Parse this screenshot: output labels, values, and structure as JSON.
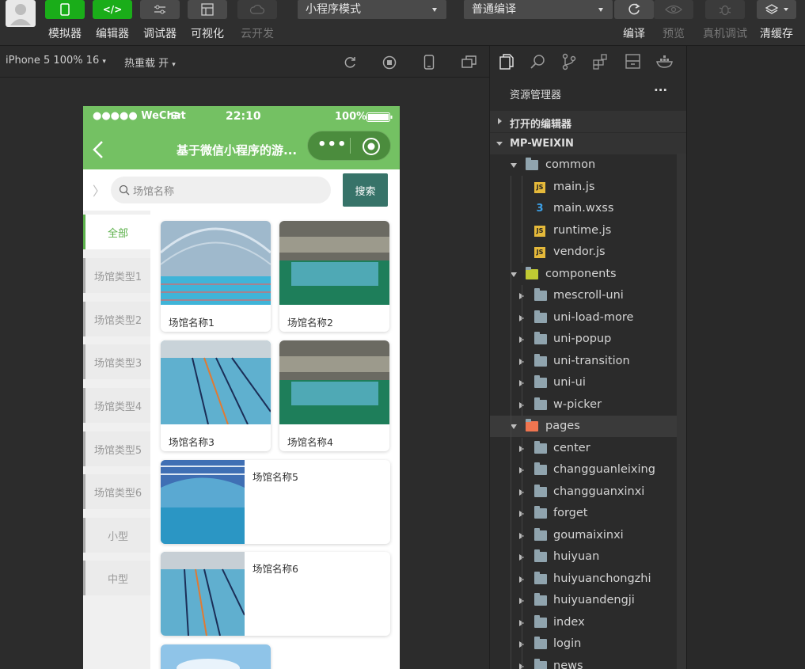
{
  "toolbar": {
    "buttons": [
      "模拟器",
      "编辑器",
      "调试器",
      "可视化",
      "云开发"
    ],
    "mode_select": "小程序模式",
    "compile_select": "普通编译",
    "right_labels": [
      "编译",
      "预览",
      "真机调试",
      "清缓存"
    ]
  },
  "subbar": {
    "device": "iPhone 5 100% 16",
    "hotreload": "热重载 开"
  },
  "phone": {
    "status": {
      "carrier": "●●●●● WeChat",
      "time": "22:10",
      "battery": "100%"
    },
    "nav_title": "基于微信小程序的游...",
    "search_placeholder": "场馆名称",
    "search_button": "搜索",
    "categories": [
      "全部",
      "场馆类型1",
      "场馆类型2",
      "场馆类型3",
      "场馆类型4",
      "场馆类型5",
      "场馆类型6",
      "小型",
      "中型"
    ],
    "cards": [
      "场馆名称1",
      "场馆名称2",
      "场馆名称3",
      "场馆名称4",
      "场馆名称5",
      "场馆名称6"
    ]
  },
  "explorer": {
    "title": "资源管理器",
    "more": "···",
    "open_editors": "打开的编辑器",
    "project": "MP-WEIXIN",
    "common": "common",
    "common_files": [
      "main.js",
      "main.wxss",
      "runtime.js",
      "vendor.js"
    ],
    "components": "components",
    "component_folders": [
      "mescroll-uni",
      "uni-load-more",
      "uni-popup",
      "uni-transition",
      "uni-ui",
      "w-picker"
    ],
    "pages": "pages",
    "page_folders": [
      "center",
      "changguanleixing",
      "changguanxinxi",
      "forget",
      "goumaixinxi",
      "huiyuan",
      "huiyuanchongzhi",
      "huiyuandengji",
      "index",
      "login",
      "news"
    ]
  },
  "colors": {
    "accent": "#1aad19",
    "navbar": "#74c163",
    "search_btn": "#377369"
  }
}
